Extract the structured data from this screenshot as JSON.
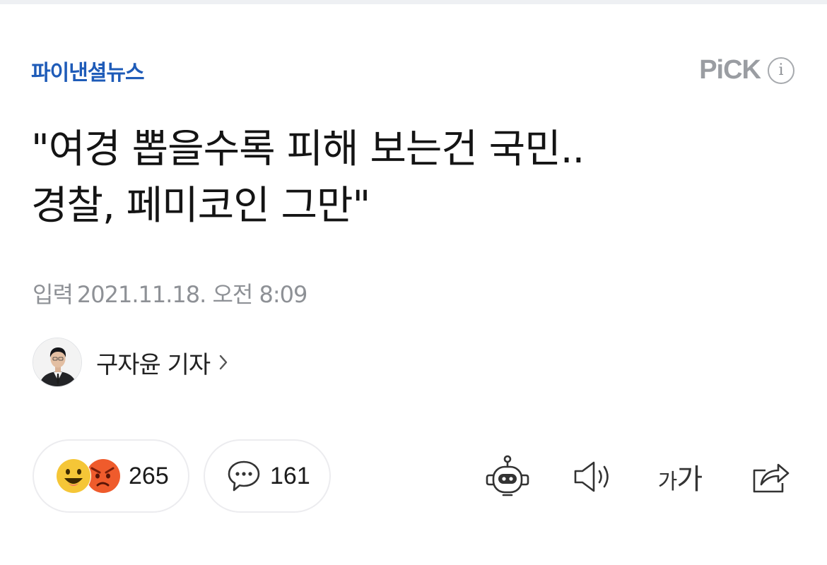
{
  "colors": {
    "press_logo_blue": "#1e5bb8",
    "pick_gray": "#9a9da2",
    "meta_gray": "#8e9196",
    "pill_border": "#ececef",
    "like_yellow": "#f5c637",
    "angry_orange": "#ef5b2c"
  },
  "header": {
    "press_logo": "파이낸셜뉴스",
    "pick_label": "PiCK",
    "info_icon": "info-icon"
  },
  "article": {
    "headline_line1": "\"여경 뽑을수록 피해 보는건 국민..",
    "headline_line2": "경찰, 페미코인 그만\"",
    "date_label": "입력",
    "date_value": "2021.11.18. 오전 8:09"
  },
  "reporter": {
    "name": "구자윤 기자"
  },
  "actions": {
    "reaction_count": "265",
    "comment_count": "161",
    "icons": [
      "like-emoji-icon",
      "angry-emoji-icon",
      "comment-bubble-icon",
      "summary-bot-icon",
      "speaker-icon",
      "font-size-icon",
      "share-icon"
    ],
    "font_size_small": "가",
    "font_size_large": "가"
  }
}
